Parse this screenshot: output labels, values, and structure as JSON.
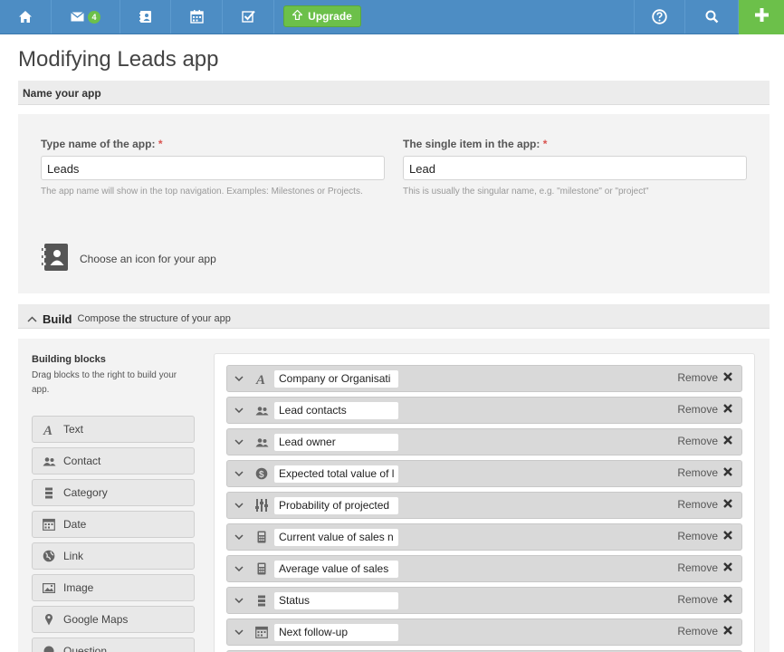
{
  "topbar": {
    "mail_badge": "4",
    "upgrade_label": "Upgrade"
  },
  "page_title": "Modifying Leads app",
  "name_section": {
    "header": "Name your app",
    "app_name_label": "Type name of the app:",
    "app_name_required": "*",
    "app_name_value": "Leads",
    "app_name_hint": "The app name will show in the top navigation. Examples: Milestones or Projects.",
    "item_name_label": "The single item in the app:",
    "item_name_required": "*",
    "item_name_value": "Lead",
    "item_name_hint": "This is usually the singular name, e.g. \"milestone\" or \"project\"",
    "icon_chooser_label": "Choose an icon for your app"
  },
  "build_section": {
    "title": "Build",
    "subtitle": "Compose the structure of your app",
    "blocks_title": "Building blocks",
    "blocks_subtitle": "Drag blocks to the right to build your app.",
    "blocks": [
      {
        "label": "Text",
        "icon": "text-icon"
      },
      {
        "label": "Contact",
        "icon": "contact-icon"
      },
      {
        "label": "Category",
        "icon": "category-icon"
      },
      {
        "label": "Date",
        "icon": "calendar-icon"
      },
      {
        "label": "Link",
        "icon": "globe-icon"
      },
      {
        "label": "Image",
        "icon": "image-icon"
      },
      {
        "label": "Google Maps",
        "icon": "map-pin-icon"
      },
      {
        "label": "Question",
        "icon": "question-icon"
      }
    ],
    "remove_label": "Remove",
    "fields": [
      {
        "name": "Company or Organisati",
        "icon": "text-icon"
      },
      {
        "name": "Lead contacts",
        "icon": "contact-icon"
      },
      {
        "name": "Lead owner",
        "icon": "contact-icon"
      },
      {
        "name": "Expected total value of l",
        "icon": "money-icon"
      },
      {
        "name": "Probability of projected",
        "icon": "progress-icon"
      },
      {
        "name": "Current value of sales n",
        "icon": "calculator-icon"
      },
      {
        "name": "Average value of sales",
        "icon": "calculator-icon"
      },
      {
        "name": "Status",
        "icon": "category-icon"
      },
      {
        "name": "Next follow-up",
        "icon": "calendar-icon"
      }
    ]
  },
  "colors": {
    "topbar": "#4d8dc4",
    "accent_green": "#6cc04a",
    "required": "#d9534f"
  }
}
